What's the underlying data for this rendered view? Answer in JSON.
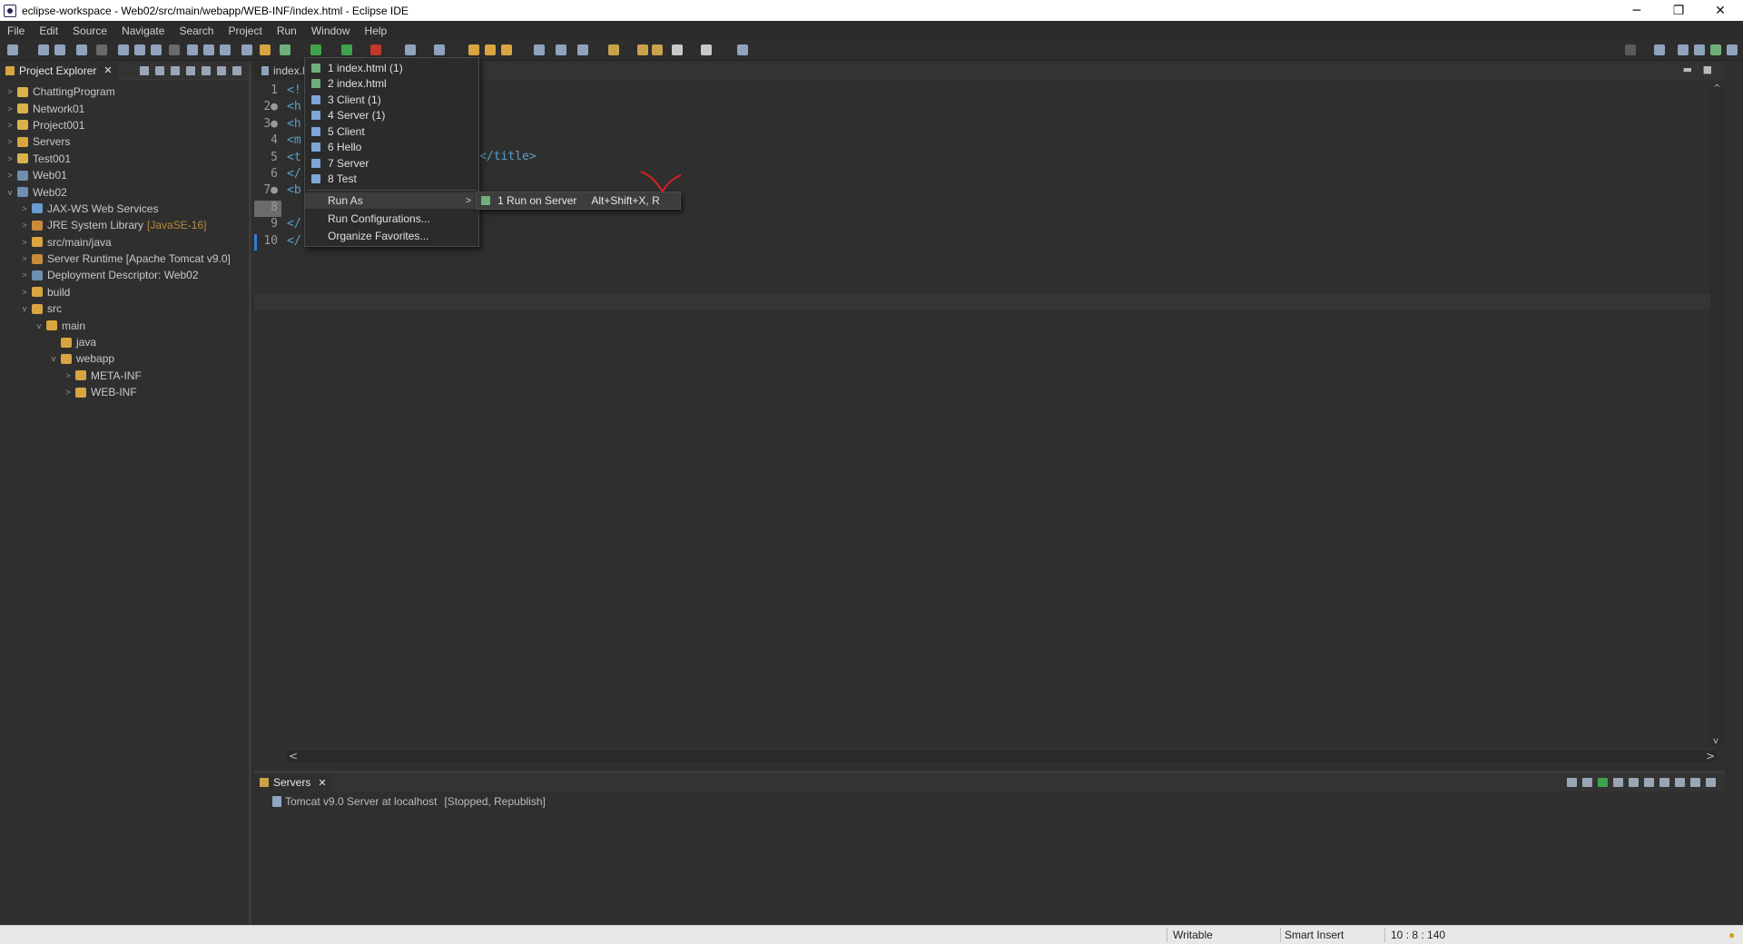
{
  "window": {
    "title": "eclipse-workspace - Web02/src/main/webapp/WEB-INF/index.html - Eclipse IDE",
    "minimize": "─",
    "restore": "❐",
    "close": "✕"
  },
  "menubar": [
    "File",
    "Edit",
    "Source",
    "Navigate",
    "Search",
    "Project",
    "Run",
    "Window",
    "Help"
  ],
  "project_explorer": {
    "tab_label": "Project Explorer",
    "tree": [
      {
        "label": "ChattingProgram",
        "indent": 0,
        "twisty": ">",
        "icon": "project-icon"
      },
      {
        "label": "Network01",
        "indent": 0,
        "twisty": ">",
        "icon": "project-icon"
      },
      {
        "label": "Project001",
        "indent": 0,
        "twisty": ">",
        "icon": "project-icon"
      },
      {
        "label": "Servers",
        "indent": 0,
        "twisty": ">",
        "icon": "folder-icon"
      },
      {
        "label": "Test001",
        "indent": 0,
        "twisty": ">",
        "icon": "project-icon"
      },
      {
        "label": "Web01",
        "indent": 0,
        "twisty": ">",
        "icon": "web-project-icon"
      },
      {
        "label": "Web02",
        "indent": 0,
        "twisty": "v",
        "icon": "web-project-icon"
      },
      {
        "label": "JAX-WS Web Services",
        "indent": 1,
        "twisty": ">",
        "icon": "web-services-icon"
      },
      {
        "label": "JRE System Library",
        "sub": "[JavaSE-16]",
        "indent": 1,
        "twisty": ">",
        "icon": "library-icon"
      },
      {
        "label": "src/main/java",
        "indent": 1,
        "twisty": ">",
        "icon": "folder-icon"
      },
      {
        "label": "Server Runtime [Apache Tomcat v9.0]",
        "indent": 1,
        "twisty": ">",
        "icon": "library-icon"
      },
      {
        "label": "Deployment Descriptor: Web02",
        "indent": 1,
        "twisty": ">",
        "icon": "descriptor-icon"
      },
      {
        "label": "build",
        "indent": 1,
        "twisty": ">",
        "icon": "folder-icon"
      },
      {
        "label": "src",
        "indent": 1,
        "twisty": "v",
        "icon": "folder-icon"
      },
      {
        "label": "main",
        "indent": 2,
        "twisty": "v",
        "icon": "folder-icon"
      },
      {
        "label": "java",
        "indent": 3,
        "twisty": "",
        "icon": "folder-icon"
      },
      {
        "label": "webapp",
        "indent": 3,
        "twisty": "v",
        "icon": "folder-icon"
      },
      {
        "label": "META-INF",
        "indent": 4,
        "twisty": ">",
        "icon": "folder-icon"
      },
      {
        "label": "WEB-INF",
        "indent": 4,
        "twisty": ">",
        "icon": "folder-icon"
      }
    ]
  },
  "editor": {
    "tab_label": "index.h",
    "line_numbers": [
      "1",
      "2●",
      "3●",
      "4",
      "5",
      "6",
      "7●",
      "8",
      "9",
      "10"
    ],
    "lines": [
      "<!",
      "<h",
      "<h",
      "<m",
      "<t",
      "</",
      "<b",
      "",
      "</",
      "</"
    ],
    "line5_tail": "</title>"
  },
  "dropdown": {
    "favorites": [
      "1 index.html (1)",
      "2 index.html",
      "3 Client (1)",
      "4 Server (1)",
      "5 Client",
      "6 Hello",
      "7 Server",
      "8 Test"
    ],
    "run_as": "Run As",
    "run_configurations": "Run Configurations...",
    "organize_favorites": "Organize Favorites..."
  },
  "submenu": {
    "item": "1 Run on Server",
    "accelerator": "Alt+Shift+X, R"
  },
  "servers_panel": {
    "tab_label": "Servers",
    "server_name": "Tomcat v9.0 Server at localhost",
    "server_state": "[Stopped, Republish]"
  },
  "statusbar": {
    "writable": "Writable",
    "insert_mode": "Smart Insert",
    "position": "10 : 8 : 140"
  }
}
